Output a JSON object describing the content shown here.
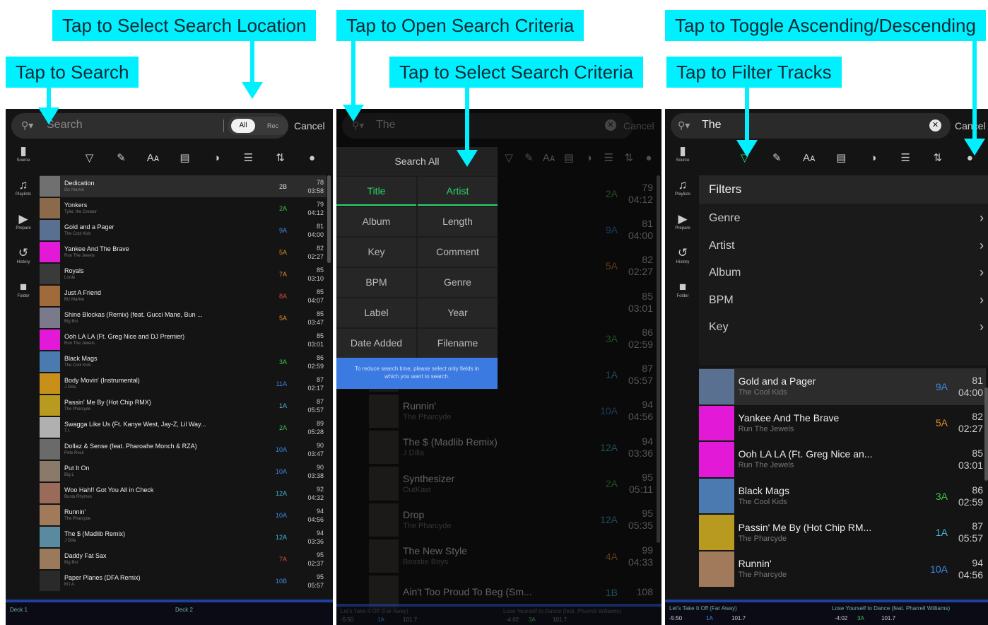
{
  "callouts": {
    "search_location": "Tap to Select Search Location",
    "search": "Tap to Search",
    "open_criteria": "Tap to Open Search Criteria",
    "select_criteria": "Tap to Select Search Criteria",
    "toggle_order": "Tap to Toggle Ascending/Descending",
    "filter": "Tap to Filter Tracks"
  },
  "colors": {
    "accent": "#00f0ff",
    "green": "#2bd46a",
    "blue": "#3b7ae0",
    "key_green": "#3ec24a",
    "key_blue": "#3b8be8",
    "key_orange": "#e08a2a",
    "key_cyan": "#44b8d8",
    "key_red": "#d64a3a"
  },
  "p1": {
    "search_placeholder": "Search",
    "all": "All",
    "rec": "Rec",
    "cancel": "Cancel",
    "sidebar": [
      {
        "icon": "usb-icon",
        "label": "Source"
      },
      {
        "icon": "playlist-icon",
        "label": "Playlists"
      },
      {
        "icon": "prepare-icon",
        "label": "Prepare"
      },
      {
        "icon": "history-icon",
        "label": "History"
      },
      {
        "icon": "folder-icon",
        "label": "Folder"
      }
    ],
    "tracks": [
      {
        "title": "Dedication",
        "artist": "Biz Markie",
        "key": "2B",
        "kc": "#dddddd",
        "bpm": "78",
        "time": "03:58",
        "art": "#707070"
      },
      {
        "title": "Yonkers",
        "artist": "Tyler, the Creator",
        "key": "2A",
        "kc": "#3ec24a",
        "bpm": "79",
        "time": "04:12",
        "art": "#8a6a4a"
      },
      {
        "title": "Gold and a Pager",
        "artist": "The Cool Kids",
        "key": "9A",
        "kc": "#3b8be8",
        "bpm": "81",
        "time": "04:00",
        "art": "#5a7090"
      },
      {
        "title": "Yankee And The Brave",
        "artist": "Run The Jewels",
        "key": "5A",
        "kc": "#e08a2a",
        "bpm": "82",
        "time": "02:27",
        "art": "#e21ad8"
      },
      {
        "title": "Royals",
        "artist": "Lorde",
        "key": "7A",
        "kc": "#e08a2a",
        "bpm": "85",
        "time": "03:10",
        "art": "#3a3a3a"
      },
      {
        "title": "Just A Friend",
        "artist": "Biz Markie",
        "key": "8A",
        "kc": "#d64a3a",
        "bpm": "85",
        "time": "04:07",
        "art": "#a06a3a"
      },
      {
        "title": "Shine Blockas (Remix) (feat. Gucci Mane, Bun ...",
        "artist": "Big Boi",
        "key": "5A",
        "kc": "#e08a2a",
        "bpm": "85",
        "time": "03:47",
        "art": "#7a7a8a"
      },
      {
        "title": "Ooh LA LA (Ft. Greg Nice and DJ Premier)",
        "artist": "Run The Jewels",
        "key": "",
        "kc": "#dddddd",
        "bpm": "85",
        "time": "03:01",
        "art": "#e21ad8"
      },
      {
        "title": "Black Mags",
        "artist": "The Cool Kids",
        "key": "3A",
        "kc": "#3ec24a",
        "bpm": "86",
        "time": "02:59",
        "art": "#4a7ab0"
      },
      {
        "title": "Body Movin' (Instrumental)",
        "artist": "J Dilla",
        "key": "11A",
        "kc": "#3b8be8",
        "bpm": "87",
        "time": "02:17",
        "art": "#c8901a"
      },
      {
        "title": "Passin' Me By (Hot Chip RMX)",
        "artist": "The Pharcyde",
        "key": "1A",
        "kc": "#44b8d8",
        "bpm": "87",
        "time": "05:57",
        "art": "#b89a20"
      },
      {
        "title": "Swagga Like Us (Ft. Kanye West, Jay-Z, Lil Way...",
        "artist": "T.I.",
        "key": "2A",
        "kc": "#3ec24a",
        "bpm": "89",
        "time": "05:28",
        "art": "#b0b0b0"
      },
      {
        "title": "Dollaz & Sense (feat. Pharoahe Monch & RZA)",
        "artist": "Pete Rock",
        "key": "10A",
        "kc": "#3b8be8",
        "bpm": "90",
        "time": "03:47",
        "art": "#6a6a6a"
      },
      {
        "title": "Put It On",
        "artist": "Big L",
        "key": "10A",
        "kc": "#3b8be8",
        "bpm": "90",
        "time": "03:38",
        "art": "#8a7a6a"
      },
      {
        "title": "Woo Hah!! Got You All in Check",
        "artist": "Busta Rhymes",
        "key": "12A",
        "kc": "#44b8d8",
        "bpm": "92",
        "time": "04:32",
        "art": "#9a6a5a"
      },
      {
        "title": "Runnin'",
        "artist": "The Pharcyde",
        "key": "10A",
        "kc": "#3b8be8",
        "bpm": "94",
        "time": "04:56",
        "art": "#a07a5a"
      },
      {
        "title": "The $ (Madlib Remix)",
        "artist": "J Dilla",
        "key": "12A",
        "kc": "#44b8d8",
        "bpm": "94",
        "time": "03:36",
        "art": "#5a8aa0"
      },
      {
        "title": "Daddy Fat Sax",
        "artist": "Big Boi",
        "key": "7A",
        "kc": "#d64a3a",
        "bpm": "95",
        "time": "02:37",
        "art": "#9a7a5a"
      },
      {
        "title": "Paper Planes (DFA Remix)",
        "artist": "M.I.A.",
        "key": "10B",
        "kc": "#3b8be8",
        "bpm": "95",
        "time": "05:57",
        "art": "#2a2a2a"
      }
    ],
    "deck1": "Deck 1",
    "deck2": "Deck 2"
  },
  "p2": {
    "search_value": "The",
    "cancel": "Cancel",
    "search_all": "Search All",
    "criteria": [
      [
        "Title",
        "Artist"
      ],
      [
        "Album",
        "Length"
      ],
      [
        "Key",
        "Comment"
      ],
      [
        "BPM",
        "Genre"
      ],
      [
        "Label",
        "Year"
      ],
      [
        "Date Added",
        "Filename"
      ]
    ],
    "tip": "To reduce search time, please select only fields in which you want to search.",
    "bg_tracks": [
      {
        "title": "",
        "artist": "",
        "key": "2A",
        "kc": "#3ec24a",
        "bpm": "79",
        "time": "04:12"
      },
      {
        "title": "",
        "artist": "",
        "key": "9A",
        "kc": "#3b8be8",
        "bpm": "81",
        "time": "04:00"
      },
      {
        "title": "e Brave",
        "artist": "",
        "key": "5A",
        "kc": "#e08a2a",
        "bpm": "82",
        "time": "02:27"
      },
      {
        "title": "Greg Nice an...",
        "artist": "",
        "key": "",
        "kc": "#dddddd",
        "bpm": "85",
        "time": "03:01"
      },
      {
        "title": "",
        "artist": "",
        "key": "3A",
        "kc": "#3ec24a",
        "bpm": "86",
        "time": "02:59"
      },
      {
        "title": "Hot Chip RM...",
        "artist": "",
        "key": "1A",
        "kc": "#44b8d8",
        "bpm": "87",
        "time": "05:57"
      },
      {
        "title": "Runnin'",
        "artist": "The Pharcyde",
        "key": "10A",
        "kc": "#3b8be8",
        "bpm": "94",
        "time": "04:56"
      },
      {
        "title": "The $ (Madlib Remix)",
        "artist": "J Dilla",
        "key": "12A",
        "kc": "#44b8d8",
        "bpm": "94",
        "time": "03:36"
      },
      {
        "title": "Synthesizer",
        "artist": "OutKast",
        "key": "2A",
        "kc": "#3ec24a",
        "bpm": "95",
        "time": "05:11"
      },
      {
        "title": "Drop",
        "artist": "The Pharcyde",
        "key": "12A",
        "kc": "#44b8d8",
        "bpm": "95",
        "time": "05:35"
      },
      {
        "title": "The New Style",
        "artist": "Beastie Boys",
        "key": "4A",
        "kc": "#e08a2a",
        "bpm": "99",
        "time": "04:33"
      },
      {
        "title": "Ain't Too Proud To Beg (Sm...",
        "artist": "",
        "key": "1B",
        "kc": "#44b8d8",
        "bpm": "108",
        "time": ""
      }
    ],
    "deck1_title": "Let's Take It Off (Far Away)",
    "deck1_pos": "-5:50",
    "deck1_key": "1A",
    "deck1_bpm": "101.7",
    "deck2_title": "Lose Yourself to Dance (feat. Pharrell Williams)",
    "deck2_pos": "-4:02",
    "deck2_key": "3A",
    "deck2_bpm": "101.7"
  },
  "p3": {
    "search_value": "The",
    "cancel": "Cancel",
    "filters_title": "Filters",
    "filters": [
      "Genre",
      "Artist",
      "Album",
      "BPM",
      "Key"
    ],
    "tracks": [
      {
        "title": "Gold and a Pager",
        "artist": "The Cool Kids",
        "key": "9A",
        "kc": "#3b8be8",
        "bpm": "81",
        "time": "04:00",
        "art": "#5a7090"
      },
      {
        "title": "Yankee And The Brave",
        "artist": "Run The Jewels",
        "key": "5A",
        "kc": "#e08a2a",
        "bpm": "82",
        "time": "02:27",
        "art": "#e21ad8"
      },
      {
        "title": "Ooh LA LA (Ft. Greg Nice an...",
        "artist": "Run The Jewels",
        "key": "",
        "kc": "#dddddd",
        "bpm": "85",
        "time": "03:01",
        "art": "#e21ad8"
      },
      {
        "title": "Black Mags",
        "artist": "The Cool Kids",
        "key": "3A",
        "kc": "#3ec24a",
        "bpm": "86",
        "time": "02:59",
        "art": "#4a7ab0"
      },
      {
        "title": "Passin' Me By (Hot Chip RM...",
        "artist": "The Pharcyde",
        "key": "1A",
        "kc": "#44b8d8",
        "bpm": "87",
        "time": "05:57",
        "art": "#b89a20"
      },
      {
        "title": "Runnin'",
        "artist": "The Pharcyde",
        "key": "10A",
        "kc": "#3b8be8",
        "bpm": "94",
        "time": "04:56",
        "art": "#a07a5a"
      }
    ],
    "deck1_title": "Let's Take It Off (Far Away)",
    "deck1_pos": "-5:50",
    "deck1_key": "1A",
    "deck1_bpm": "101.7",
    "deck2_title": "Lose Yourself to Dance (feat. Pharrell Williams)",
    "deck2_pos": "-4:02",
    "deck2_key": "3A",
    "deck2_bpm": "101.7"
  },
  "toolbar_icons": [
    "filter-icon",
    "edit-icon",
    "font-icon",
    "playlist-add-icon",
    "color-icon",
    "list-icon",
    "sort-icon",
    "sort-order-icon"
  ]
}
